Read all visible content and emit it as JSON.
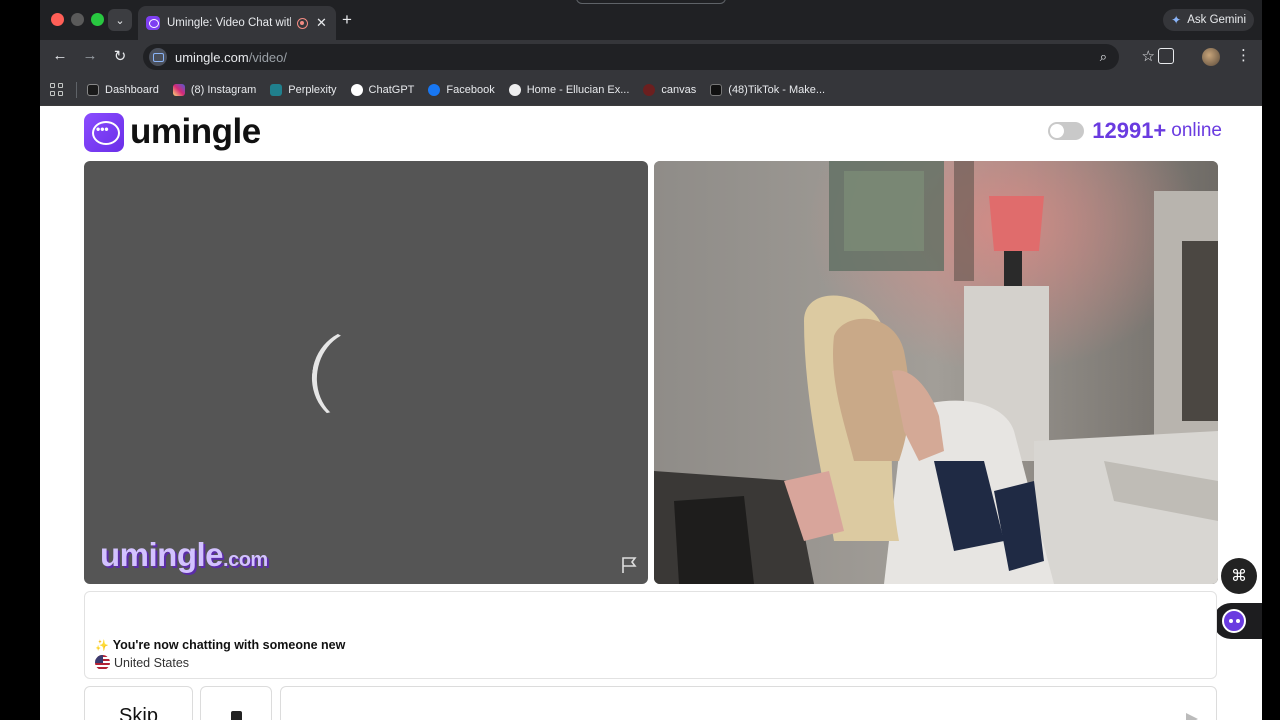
{
  "browser": {
    "tab_title": "Umingle: Video Chat with",
    "tab_close": "✕",
    "new_tab": "+",
    "ask_gemini": "Ask Gemini",
    "url_host": "umingle.com",
    "url_path": "/video/",
    "bookmarks": [
      {
        "label": "Dashboard",
        "color": "#1a1a1a"
      },
      {
        "label": "(8) Instagram",
        "color": "#d62976"
      },
      {
        "label": "Perplexity",
        "color": "#20808d"
      },
      {
        "label": "ChatGPT",
        "color": "#ffffff"
      },
      {
        "label": "Facebook",
        "color": "#1877f2"
      },
      {
        "label": "Home - Ellucian Ex...",
        "color": "#eeeeee"
      },
      {
        "label": "canvas",
        "color": "#e13c3c"
      },
      {
        "label": "(48)TikTok - Make...",
        "color": "#111111"
      }
    ]
  },
  "site": {
    "logo_text": "umingle",
    "online_count": "12991+",
    "online_label": "online",
    "watermark": "umingle",
    "watermark_domain": ".com",
    "accent": "#6a3be0"
  },
  "chat": {
    "status_message": "You're now chatting with someone new",
    "country": "United States"
  },
  "controls": {
    "skip_label": "Skip"
  }
}
